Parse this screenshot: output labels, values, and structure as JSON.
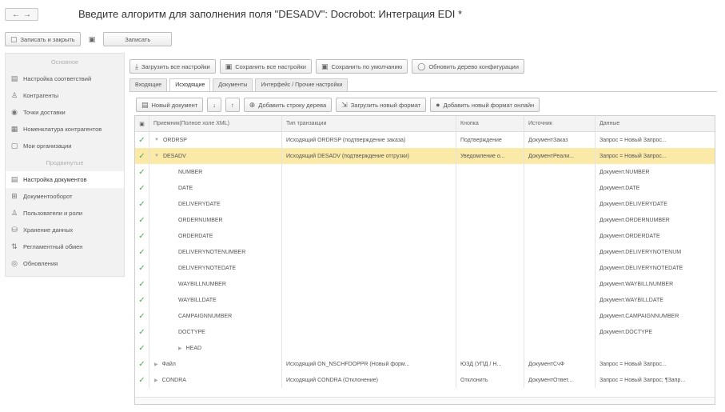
{
  "window": {
    "back_arrow": "←",
    "forward_arrow": "→",
    "title": "Введите алгоритм для заполнения поля \"DESADV\": Docrobot: Интеграция EDI *"
  },
  "commands": {
    "save_close": "Записать и закрыть",
    "save": "Записать"
  },
  "sidebar": {
    "items": [
      {
        "label": "Основное",
        "icon": "",
        "header": true
      },
      {
        "label": "Настройка соответствий",
        "icon": "doc-icon"
      },
      {
        "label": "Контрагенты",
        "icon": "people-icon"
      },
      {
        "label": "Точки доставки",
        "icon": "pin-icon"
      },
      {
        "label": "Номенклатура контрагентов",
        "icon": "list-icon"
      },
      {
        "label": "Мои организации",
        "icon": "org-icon"
      },
      {
        "label": "Продвинутые",
        "icon": "",
        "header": true
      },
      {
        "label": "Настройка документов",
        "icon": "doc-icon",
        "active": true
      },
      {
        "label": "Документооборот",
        "icon": "flow-icon"
      },
      {
        "label": "Пользователи и роли",
        "icon": "user-icon"
      },
      {
        "label": "Хранение данных",
        "icon": "db-icon"
      },
      {
        "label": "Регламентный обмен",
        "icon": "exchange-icon"
      },
      {
        "label": "Обновления",
        "icon": "refresh-icon"
      }
    ]
  },
  "toolbar1": {
    "load_all": "Загрузить все настройки",
    "save_all": "Сохранить все настройки",
    "save_default": "Сохранить по умолчанию",
    "update_config": "Обновить дерево конфигурации"
  },
  "tabs": [
    "Входящие",
    "Исходящие",
    "Документы",
    "Интерфейс / Прочие настройки"
  ],
  "toolbar2": {
    "new_doc": "Новый документ",
    "down": "↓",
    "up": "↑",
    "add_row": "Добавить строку дерева",
    "load_format": "Загрузить новый формат",
    "add_format_online": "Добавить новый формат онлайн"
  },
  "table": {
    "columns": [
      "Приемник(Полное холе XML)",
      "Тип транзакции",
      "Кнопка",
      "Источник",
      "Данные"
    ],
    "rows": [
      {
        "indent": 0,
        "expand": "▼",
        "name": "ORDRSP",
        "type": "Исходящий ORDRSP (подтверждение заказа)",
        "button": "Подтверждение",
        "source": "ДокументЗаказ",
        "data": "Запрос = Новый Запрос..."
      },
      {
        "indent": 0,
        "expand": "▼",
        "name": "DESADV",
        "type": "Исходящий DESADV (подтверждение отгрузки)",
        "button": "Уведомление о...",
        "source": "ДокументРеали...",
        "data": "Запрос = Новый Запрос...",
        "selected": true
      },
      {
        "indent": 1,
        "expand": "",
        "name": "NUMBER",
        "type": "",
        "button": "",
        "source": "",
        "data": "Документ.NUMBER"
      },
      {
        "indent": 1,
        "expand": "",
        "name": "DATE",
        "type": "",
        "button": "",
        "source": "",
        "data": "Документ.DATE"
      },
      {
        "indent": 1,
        "expand": "",
        "name": "DELIVERYDATE",
        "type": "",
        "button": "",
        "source": "",
        "data": "Документ.DELIVERYDATE"
      },
      {
        "indent": 1,
        "expand": "",
        "name": "ORDERNUMBER",
        "type": "",
        "button": "",
        "source": "",
        "data": "Документ.ORDERNUMBER"
      },
      {
        "indent": 1,
        "expand": "",
        "name": "ORDERDATE",
        "type": "",
        "button": "",
        "source": "",
        "data": "Документ.ORDERDATE"
      },
      {
        "indent": 1,
        "expand": "",
        "name": "DELIVERYNOTENUMBER",
        "type": "",
        "button": "",
        "source": "",
        "data": "Документ.DELIVERYNOTENUM"
      },
      {
        "indent": 1,
        "expand": "",
        "name": "DELIVERYNOTEDATE",
        "type": "",
        "button": "",
        "source": "",
        "data": "Документ.DELIVERYNOTEDATE"
      },
      {
        "indent": 1,
        "expand": "",
        "name": "WAYBILLNUMBER",
        "type": "",
        "button": "",
        "source": "",
        "data": "Документ.WAYBILLNUMBER"
      },
      {
        "indent": 1,
        "expand": "",
        "name": "WAYBILLDATE",
        "type": "",
        "button": "",
        "source": "",
        "data": "Документ.WAYBILLDATE"
      },
      {
        "indent": 1,
        "expand": "",
        "name": "CAMPAIGNNUMBER",
        "type": "",
        "button": "",
        "source": "",
        "data": "Документ.CAMPAIGNNUMBER"
      },
      {
        "indent": 1,
        "expand": "",
        "name": "DOCTYPE",
        "type": "",
        "button": "",
        "source": "",
        "data": "Документ.DOCTYPE"
      },
      {
        "indent": 1,
        "expand": "▶",
        "name": "HEAD",
        "type": "",
        "button": "",
        "source": "",
        "data": ""
      },
      {
        "indent": 0,
        "expand": "▶",
        "name": "Файл",
        "type": "Исходящий ON_NSCHFDOPPR (Новый форм...",
        "button": "ЮЗД (УПД / Н...",
        "source": "ДокументСчФ",
        "data": "Запрос = Новый Запрос..."
      },
      {
        "indent": 0,
        "expand": "▶",
        "name": "CONDRA",
        "type": "Исходящий CONDRA (Отклонение)",
        "button": "Отклонить",
        "source": "ДокументОтвет...",
        "data": "Запрос = Новый Запрос; ¶Запр..."
      }
    ]
  }
}
